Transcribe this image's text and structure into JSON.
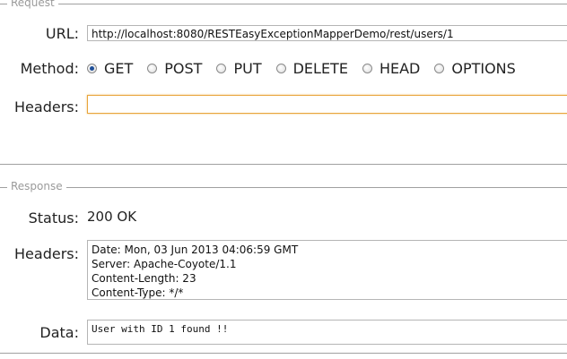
{
  "request": {
    "legend": "Request",
    "url_label": "URL:",
    "url_value": "http://localhost:8080/RESTEasyExceptionMapperDemo/rest/users/1",
    "method_label": "Method:",
    "methods": [
      {
        "label": "GET",
        "checked": true
      },
      {
        "label": "POST",
        "checked": false
      },
      {
        "label": "PUT",
        "checked": false
      },
      {
        "label": "DELETE",
        "checked": false
      },
      {
        "label": "HEAD",
        "checked": false
      },
      {
        "label": "OPTIONS",
        "checked": false
      }
    ],
    "headers_label": "Headers:",
    "headers_value": ""
  },
  "response": {
    "legend": "Response",
    "status_label": "Status:",
    "status_value": "200 OK",
    "headers_label": "Headers:",
    "headers_lines": [
      "Date: Mon, 03 Jun 2013 04:06:59 GMT",
      "Server: Apache-Coyote/1.1",
      "Content-Length: 23",
      "Content-Type: */*"
    ],
    "data_label": "Data:",
    "data_value": "User with ID 1 found !!"
  }
}
